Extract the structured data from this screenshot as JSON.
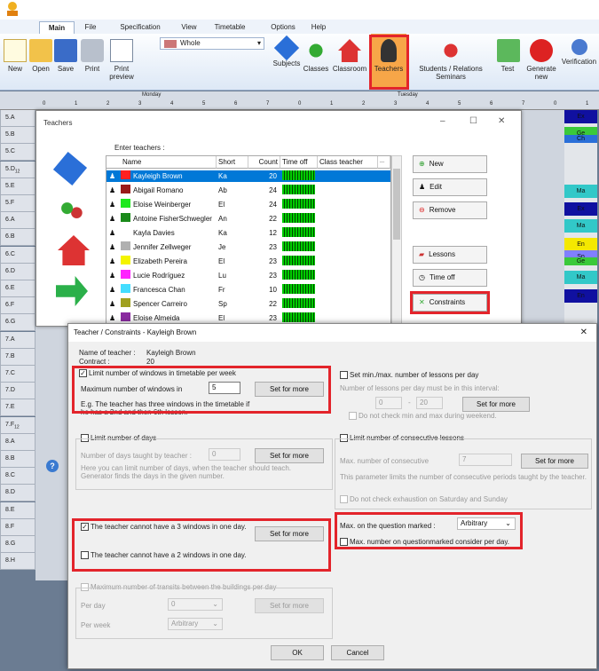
{
  "ribbon": {
    "tabs": [
      "Main",
      "File",
      "Specification",
      "View",
      "Timetable",
      "Options",
      "Help"
    ],
    "buttons": [
      {
        "label": "New"
      },
      {
        "label": "Open"
      },
      {
        "label": "Save"
      },
      {
        "label": "Print"
      },
      {
        "label": "Print\npreview"
      },
      {
        "label": "Subjects"
      },
      {
        "label": "Classes"
      },
      {
        "label": "Classroom"
      },
      {
        "label": "Teachers"
      },
      {
        "label": "Students / Relations\nSeminars"
      },
      {
        "label": "Test"
      },
      {
        "label": "Generate\nnew"
      },
      {
        "label": "Verification"
      }
    ],
    "combo_value": "Whole"
  },
  "grid": {
    "day1": "Monday",
    "day2": "Tuesday",
    "periods": [
      "0",
      "1",
      "2",
      "3",
      "4",
      "5",
      "6",
      "7",
      "0",
      "1",
      "2",
      "3",
      "4",
      "5",
      "6",
      "7",
      "0",
      "1"
    ],
    "rows": [
      "5.A",
      "5.B",
      "5.C",
      "5.D",
      "5.E",
      "5.F",
      "6.A",
      "6.B",
      "6.C",
      "6.D",
      "6.E",
      "6.F",
      "6.G",
      "7.A",
      "7.B",
      "7.C",
      "7.D",
      "7.E",
      "7.F",
      "8.A",
      "8.B",
      "8.C",
      "8.D",
      "8.E",
      "8.F",
      "8.G",
      "8.H"
    ],
    "row_subs": {
      "5.D": "12",
      "7.F": "12"
    },
    "right_cells": [
      {
        "t": "Ex",
        "c": "#1010a0"
      },
      {
        "t": "Ge",
        "c": "#3ac93a"
      },
      {
        "t": "Ch",
        "c": "#2a6fd8"
      },
      {
        "t": "Ma",
        "c": "#32c8c8"
      },
      {
        "t": "Ex",
        "c": "#1010a0"
      },
      {
        "t": "Ma",
        "c": "#32c8c8"
      },
      {
        "t": "En",
        "c": "#f4e800"
      },
      {
        "t": "Sp",
        "c": "#8080ff"
      },
      {
        "t": "Ge",
        "c": "#3ac93a"
      },
      {
        "t": "Ma",
        "c": "#32c8c8"
      },
      {
        "t": "En",
        "c": "#1010a0"
      }
    ]
  },
  "teachers": {
    "title": "Teachers",
    "enter_label": "Enter teachers :",
    "columns": [
      "Name",
      "Short",
      "Count",
      "Time off",
      "Class teacher",
      "..."
    ],
    "rows": [
      {
        "name": "Kayleigh Brown",
        "short": "Ka",
        "count": "20",
        "color": "#ff2020",
        "sel": true
      },
      {
        "name": "Abigail Romano",
        "short": "Ab",
        "count": "24",
        "color": "#9a1a1a"
      },
      {
        "name": "Eloise Weinberger",
        "short": "El",
        "count": "24",
        "color": "#1ee81e"
      },
      {
        "name": "Antoine FisherSchwegler",
        "short": "An",
        "count": "22",
        "color": "#1a8a1a"
      },
      {
        "name": "Kayla Davies",
        "short": "Ka",
        "count": "12",
        "color": ""
      },
      {
        "name": "Jennifer Zellweger",
        "short": "Je",
        "count": "23",
        "color": "#b0b0b0"
      },
      {
        "name": "Elizabeth Pereira",
        "short": "El",
        "count": "23",
        "color": "#f4f400"
      },
      {
        "name": "Lucie Rodríguez",
        "short": "Lu",
        "count": "23",
        "color": "#ff22ff"
      },
      {
        "name": "Francesca Chan",
        "short": "Fr",
        "count": "10",
        "color": "#44ddff"
      },
      {
        "name": "Spencer Carreiro",
        "short": "Sp",
        "count": "22",
        "color": "#a0a020"
      },
      {
        "name": "Eloise Almeida",
        "short": "El",
        "count": "23",
        "color": "#8a2aa0"
      }
    ],
    "buttons": {
      "new": "New",
      "edit": "Edit",
      "remove": "Remove",
      "lessons": "Lessons",
      "time_off": "Time off",
      "constraints": "Constraints"
    }
  },
  "constraints": {
    "title": "Teacher / Constraints - Kayleigh Brown",
    "name_label": "Name of teacher :",
    "name_value": "Kayleigh Brown",
    "contract_label": "Contract :",
    "contract_value": "20",
    "limit_windows": "Limit number of windows in timetable per week",
    "max_windows_label": "Maximum number of windows in",
    "max_windows_value": "5",
    "set_for_more": "Set for more",
    "windows_example": "E.g. The teacher has three windows in the timetable if he has a 2nd and then 6th lesson.",
    "limit_days": "Limit number of days",
    "days_label": "Number of days taught by teacher :",
    "days_value": "0",
    "days_help": "Here you can limit number of days, when the teacher should teach. Generator finds the days in the given number.",
    "no3": "The teacher cannot have a 3 windows in one day.",
    "no2": "The teacher cannot have a 2 windows in one day.",
    "transits": "Maximum number of transits between the buildings per day",
    "per_day": "Per day",
    "per_day_value": "0",
    "per_week": "Per week",
    "per_week_value": "Arbitrary",
    "minmax": "Set min./max. number of lessons per day",
    "minmax_help": "Number of lessons per day must be in this interval:",
    "min_value": "0",
    "max_value": "20",
    "no_weekend": "Do not check min and max during weekend.",
    "consecutive": "Limit number of consecutive lessons",
    "consec_label": "Max. number of consecutive",
    "consec_value": "7",
    "consec_help": "This parameter limits the number of consecutive periods taught by the teacher.",
    "no_exhaust": "Do not check exhaustion on Saturday and Sunday",
    "q_label": "Max. on the question marked :",
    "q_value": "Arbitrary",
    "q_per_day": "Max. number on questionmarked consider per day.",
    "ok": "OK",
    "cancel": "Cancel"
  }
}
